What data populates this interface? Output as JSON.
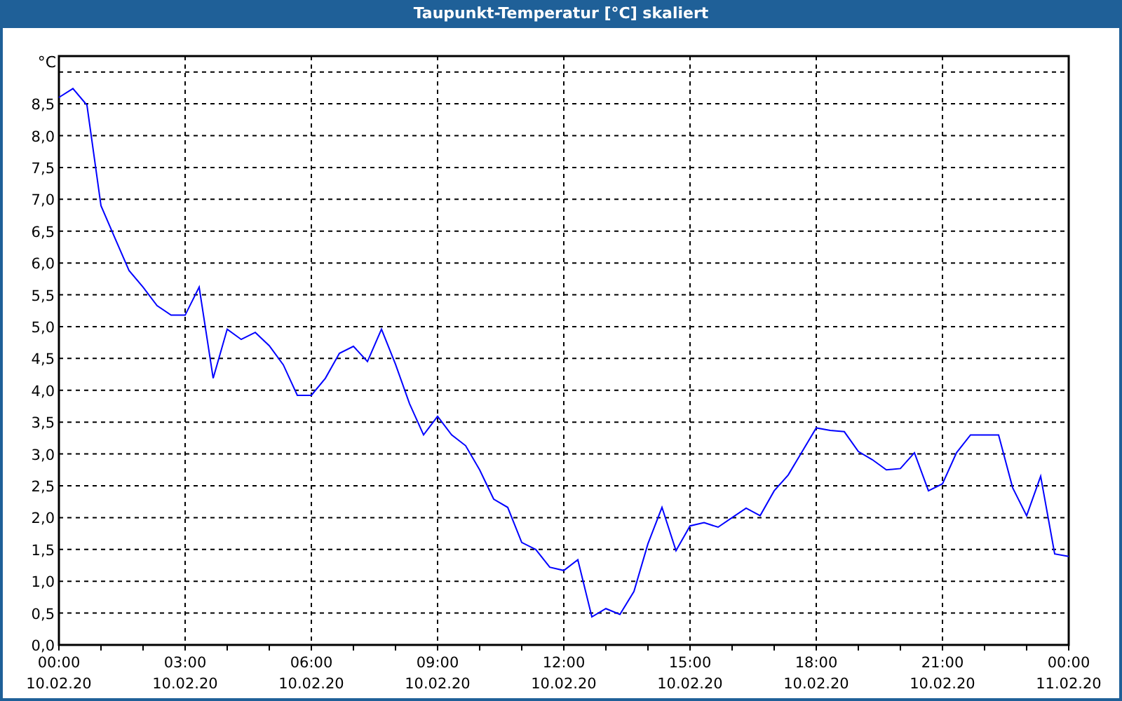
{
  "window": {
    "title": "Taupunkt-Temperatur [°C] skaliert"
  },
  "chart": {
    "chart_data": {
      "type": "line",
      "grid": true,
      "ylabel": "°C",
      "ylim": [
        0,
        9.25
      ],
      "categories": [
        "00:00\n10.02.20",
        null,
        null,
        null,
        null,
        null,
        null,
        null,
        null,
        "03:00\n10.02.20",
        null,
        null,
        null,
        null,
        null,
        null,
        null,
        null,
        "06:00\n10.02.20",
        null,
        null,
        null,
        null,
        null,
        null,
        null,
        null,
        "09:00\n10.02.20",
        null,
        null,
        null,
        null,
        null,
        null,
        null,
        null,
        "12:00\n10.02.20",
        null,
        null,
        null,
        null,
        null,
        null,
        null,
        null,
        "15:00\n10.02.20",
        null,
        null,
        null,
        null,
        null,
        null,
        null,
        null,
        "18:00\n10.02.20",
        null,
        null,
        null,
        null,
        null,
        null,
        null,
        null,
        "21:00\n10.02.20",
        null,
        null,
        null,
        null,
        null,
        null,
        null,
        null,
        "00:00\n11.02.20"
      ],
      "series": [
        {
          "color": "#0000ff",
          "values": [
            8.6,
            8.74,
            8.48,
            6.9,
            6.39,
            5.88,
            5.62,
            5.33,
            5.18,
            5.18,
            5.62,
            4.19,
            4.96,
            4.8,
            4.91,
            4.7,
            4.4,
            3.92,
            3.92,
            4.19,
            4.58,
            4.69,
            4.45,
            4.96,
            4.41,
            3.79,
            3.3,
            3.59,
            3.3,
            3.13,
            2.75,
            2.29,
            2.16,
            1.61,
            1.5,
            1.22,
            1.17,
            1.34,
            0.44,
            0.57,
            0.48,
            0.84,
            1.59,
            2.16,
            1.48,
            1.87,
            1.92,
            1.85,
            2.0,
            2.15,
            2.03,
            2.42,
            2.67,
            3.04,
            3.41,
            3.37,
            3.35,
            3.04,
            2.91,
            2.75,
            2.77,
            3.02,
            2.42,
            2.53,
            3.02,
            3.3,
            3.3,
            3.3,
            2.47,
            2.03,
            2.65,
            1.43,
            1.39
          ]
        }
      ],
      "yticks": [
        {
          "value": 0,
          "label": "0,0"
        },
        {
          "value": 0.5,
          "label": "0,5"
        },
        {
          "value": 1,
          "label": "1,0"
        },
        {
          "value": 1.5,
          "label": "1,5"
        },
        {
          "value": 2,
          "label": "2,0"
        },
        {
          "value": 2.5,
          "label": "2,5"
        },
        {
          "value": 3,
          "label": "3,0"
        },
        {
          "value": 3.5,
          "label": "3,5"
        },
        {
          "value": 4,
          "label": "4,0"
        },
        {
          "value": 4.5,
          "label": "4,5"
        },
        {
          "value": 5,
          "label": "5,0"
        },
        {
          "value": 5.5,
          "label": "5,5"
        },
        {
          "value": 6,
          "label": "6,0"
        },
        {
          "value": 6.5,
          "label": "6,5"
        },
        {
          "value": 7,
          "label": "7,0"
        },
        {
          "value": 7.5,
          "label": "7,5"
        },
        {
          "value": 8,
          "label": "8,0"
        },
        {
          "value": 8.5,
          "label": "8,5"
        }
      ]
    }
  }
}
